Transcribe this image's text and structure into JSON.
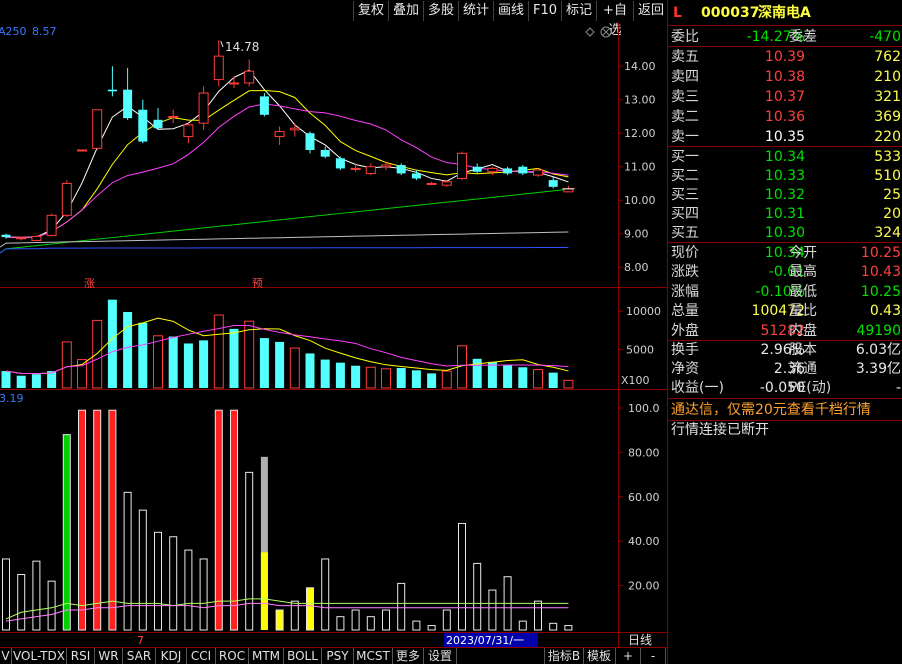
{
  "toolbar": {
    "buttons": [
      "复权",
      "叠加",
      "多股",
      "统计",
      "画线",
      "F10",
      "标记",
      "+自选",
      "返回"
    ]
  },
  "main_chart": {
    "indicator_label": "A250",
    "indicator_value": "8.57",
    "high_label": "14.78",
    "marker_limit_up": "涨",
    "marker_forecast": "预",
    "y_ticks": [
      "14.00",
      "13.00",
      "12.00",
      "11.00",
      "10.00",
      "9.00",
      "8.00"
    ]
  },
  "volume_chart": {
    "y_ticks": [
      "10000",
      "5000"
    ],
    "unit_label": "X100"
  },
  "osc_chart": {
    "value_label": "3.19",
    "y_ticks": [
      "100.0",
      "80.00",
      "60.00",
      "40.00",
      "20.00"
    ]
  },
  "cursor": {
    "date": "2023/07/31/一",
    "tick_number": "7"
  },
  "period": {
    "label": "日线"
  },
  "tabs": [
    "V",
    "VOL-TDX",
    "RSI",
    "WR",
    "SAR",
    "KDJ",
    "CCI",
    "ROC",
    "MTM",
    "BOLL",
    "PSY",
    "MCST",
    "更多",
    "设置"
  ],
  "bottom_right": [
    "指标B",
    "模板",
    "+",
    "-"
  ],
  "quote": {
    "flag": "L",
    "code": "000037",
    "name": "深南电A",
    "weibi_label": "委比",
    "weibi_value": "-14.27%",
    "weicha_label": "委差",
    "weicha_value": "-470",
    "asks": [
      {
        "label": "卖五",
        "price": "10.39",
        "vol": "762"
      },
      {
        "label": "卖四",
        "price": "10.38",
        "vol": "210"
      },
      {
        "label": "卖三",
        "price": "10.37",
        "vol": "321"
      },
      {
        "label": "卖二",
        "price": "10.36",
        "vol": "369"
      },
      {
        "label": "卖一",
        "price": "10.35",
        "vol": "220"
      }
    ],
    "bids": [
      {
        "label": "买一",
        "price": "10.34",
        "vol": "533"
      },
      {
        "label": "买二",
        "price": "10.33",
        "vol": "510"
      },
      {
        "label": "买三",
        "price": "10.32",
        "vol": "25"
      },
      {
        "label": "买四",
        "price": "10.31",
        "vol": "20"
      },
      {
        "label": "买五",
        "price": "10.30",
        "vol": "324"
      }
    ],
    "stats": [
      {
        "l1": "现价",
        "v1": "10.34",
        "l2": "今开",
        "v2": "10.25"
      },
      {
        "l1": "涨跌",
        "v1": "-0.01",
        "l2": "最高",
        "v2": "10.43"
      },
      {
        "l1": "涨幅",
        "v1": "-0.10%",
        "l2": "最低",
        "v2": "10.25"
      },
      {
        "l1": "总量",
        "v1": "100472",
        "l2": "量比",
        "v2": "0.43"
      },
      {
        "l1": "外盘",
        "v1": "51282",
        "l2": "内盘",
        "v2": "49190"
      }
    ],
    "stats2": [
      {
        "l1": "换手",
        "v1": "2.96%",
        "l2": "股本",
        "v2": "6.03亿"
      },
      {
        "l1": "净资",
        "v1": "2.36",
        "l2": "流通",
        "v2": "3.39亿"
      },
      {
        "l1": "收益(一)",
        "v1": "-0.050",
        "l2": "PE(动)",
        "v2": "-"
      }
    ],
    "notice": "通达信，仅需20元查看千档行情",
    "status": "行情连接已断开"
  },
  "colors": {
    "up": "#ff3c3c",
    "down": "#54ffff",
    "green_value": "#00e000",
    "yellow": "#ffff50",
    "ma5": "#ffffff",
    "ma10": "#ffff00",
    "ma20": "#ff40ff",
    "ma60": "#00d000",
    "ma120": "#c0c0c0",
    "ma250": "#3050ff",
    "grid": "#8a0000"
  },
  "chart_data": {
    "type": "candlestick",
    "dates_visible": [
      "2023/07/31"
    ],
    "candles": [
      {
        "o": 8.97,
        "h": 9.0,
        "l": 8.85,
        "c": 8.9
      },
      {
        "o": 8.85,
        "h": 8.92,
        "l": 8.8,
        "c": 8.88
      },
      {
        "o": 8.8,
        "h": 8.95,
        "l": 8.78,
        "c": 8.92
      },
      {
        "o": 8.95,
        "h": 9.6,
        "l": 8.95,
        "c": 9.55
      },
      {
        "o": 9.55,
        "h": 10.6,
        "l": 9.5,
        "c": 10.5
      },
      {
        "o": 11.5,
        "h": 11.5,
        "l": 11.45,
        "c": 11.5
      },
      {
        "o": 11.55,
        "h": 12.7,
        "l": 11.5,
        "c": 12.7
      },
      {
        "o": 13.3,
        "h": 14.0,
        "l": 13.1,
        "c": 13.25
      },
      {
        "o": 13.3,
        "h": 13.95,
        "l": 12.4,
        "c": 12.45
      },
      {
        "o": 12.7,
        "h": 13.0,
        "l": 11.7,
        "c": 11.75
      },
      {
        "o": 12.4,
        "h": 12.75,
        "l": 12.1,
        "c": 12.15
      },
      {
        "o": 12.5,
        "h": 12.7,
        "l": 12.3,
        "c": 12.5
      },
      {
        "o": 11.9,
        "h": 12.3,
        "l": 11.7,
        "c": 12.25
      },
      {
        "o": 12.3,
        "h": 13.4,
        "l": 12.1,
        "c": 13.2
      },
      {
        "o": 13.6,
        "h": 14.78,
        "l": 13.4,
        "c": 14.3
      },
      {
        "o": 13.5,
        "h": 13.7,
        "l": 13.35,
        "c": 13.5
      },
      {
        "o": 13.5,
        "h": 14.2,
        "l": 13.4,
        "c": 13.85
      },
      {
        "o": 13.1,
        "h": 13.2,
        "l": 12.5,
        "c": 12.55
      },
      {
        "o": 11.9,
        "h": 12.2,
        "l": 11.65,
        "c": 12.05
      },
      {
        "o": 12.1,
        "h": 12.3,
        "l": 11.9,
        "c": 12.15
      },
      {
        "o": 12.0,
        "h": 12.05,
        "l": 11.4,
        "c": 11.5
      },
      {
        "o": 11.5,
        "h": 11.6,
        "l": 11.25,
        "c": 11.3
      },
      {
        "o": 11.25,
        "h": 11.3,
        "l": 10.9,
        "c": 10.95
      },
      {
        "o": 10.95,
        "h": 11.1,
        "l": 10.85,
        "c": 10.95
      },
      {
        "o": 10.8,
        "h": 11.1,
        "l": 10.75,
        "c": 11.0
      },
      {
        "o": 11.0,
        "h": 11.15,
        "l": 10.9,
        "c": 11.05
      },
      {
        "o": 11.05,
        "h": 11.1,
        "l": 10.75,
        "c": 10.8
      },
      {
        "o": 10.8,
        "h": 10.9,
        "l": 10.6,
        "c": 10.65
      },
      {
        "o": 10.5,
        "h": 10.55,
        "l": 10.45,
        "c": 10.5
      },
      {
        "o": 10.45,
        "h": 10.6,
        "l": 10.4,
        "c": 10.55
      },
      {
        "o": 10.65,
        "h": 11.45,
        "l": 10.6,
        "c": 11.4
      },
      {
        "o": 11.0,
        "h": 11.1,
        "l": 10.8,
        "c": 10.85
      },
      {
        "o": 10.85,
        "h": 11.0,
        "l": 10.75,
        "c": 10.95
      },
      {
        "o": 10.95,
        "h": 11.0,
        "l": 10.75,
        "c": 10.8
      },
      {
        "o": 11.0,
        "h": 11.05,
        "l": 10.75,
        "c": 10.8
      },
      {
        "o": 10.75,
        "h": 10.95,
        "l": 10.7,
        "c": 10.9
      },
      {
        "o": 10.6,
        "h": 10.7,
        "l": 10.35,
        "c": 10.4
      },
      {
        "o": 10.25,
        "h": 10.43,
        "l": 10.25,
        "c": 10.34
      }
    ],
    "volume": [
      2200,
      1600,
      1800,
      2200,
      6000,
      3700,
      8800,
      11500,
      9900,
      8500,
      6800,
      6700,
      5800,
      6200,
      9500,
      7700,
      8700,
      6500,
      6000,
      5200,
      4500,
      3700,
      3300,
      2900,
      2700,
      2500,
      2600,
      2300,
      1900,
      2200,
      5500,
      3800,
      3400,
      3000,
      2700,
      2400,
      2000,
      1000
    ],
    "volume_up": [
      false,
      false,
      false,
      false,
      true,
      true,
      true,
      false,
      false,
      false,
      true,
      false,
      false,
      false,
      true,
      false,
      true,
      false,
      false,
      true,
      false,
      false,
      false,
      false,
      true,
      true,
      false,
      false,
      false,
      true,
      true,
      false,
      false,
      false,
      false,
      true,
      false,
      true
    ],
    "osc": [
      32,
      25,
      31,
      22,
      88,
      99,
      99,
      99,
      62,
      54,
      44,
      42,
      36,
      32,
      99,
      99,
      71,
      78,
      9,
      13,
      19,
      32,
      6,
      9,
      6,
      9,
      21,
      4,
      2,
      9,
      48,
      30,
      18,
      24,
      4,
      13,
      3,
      2
    ],
    "osc_type": [
      "w",
      "w",
      "w",
      "w",
      "g",
      "r",
      "r",
      "r",
      "w",
      "w",
      "w",
      "w",
      "w",
      "w",
      "r",
      "r",
      "w",
      "s",
      "y",
      "w",
      "y",
      "w",
      "w",
      "w",
      "w",
      "w",
      "w",
      "w",
      "w",
      "w",
      "w",
      "w",
      "w",
      "w",
      "w",
      "w",
      "w",
      "w"
    ],
    "ylim_price": [
      7.5,
      15.2
    ],
    "ylim_volume": [
      0,
      12500
    ],
    "ylim_osc": [
      0,
      100
    ]
  }
}
